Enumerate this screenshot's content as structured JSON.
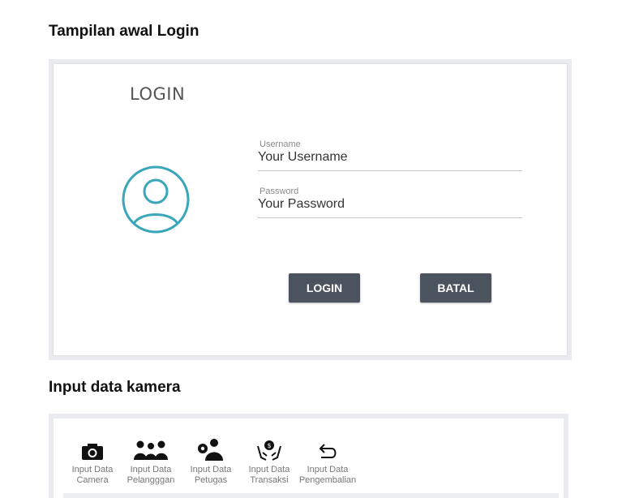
{
  "section1": {
    "heading": "Tampilan awal Login"
  },
  "login": {
    "title": "LOGIN",
    "username": {
      "label": "Username",
      "placeholder": "Your Username"
    },
    "password": {
      "label": "Password",
      "placeholder": "Your Password"
    },
    "buttons": {
      "login": "LOGIN",
      "batal": "BATAL"
    },
    "avatar_color": "#3aa6b9",
    "button_color": "#4b535e"
  },
  "section2": {
    "heading": "Input data kamera"
  },
  "menu": {
    "items": [
      {
        "icon": "camera-icon",
        "line1": "Input Data",
        "line2": "Camera"
      },
      {
        "icon": "customers-icon",
        "line1": "Input Data",
        "line2": "Pelangggan"
      },
      {
        "icon": "staff-icon",
        "line1": "Input Data",
        "line2": "Petugas"
      },
      {
        "icon": "transaction-icon",
        "line1": "Input Data",
        "line2": "Transaksi"
      },
      {
        "icon": "return-icon",
        "line1": "Input Data",
        "line2": "Pengembalian"
      }
    ]
  }
}
